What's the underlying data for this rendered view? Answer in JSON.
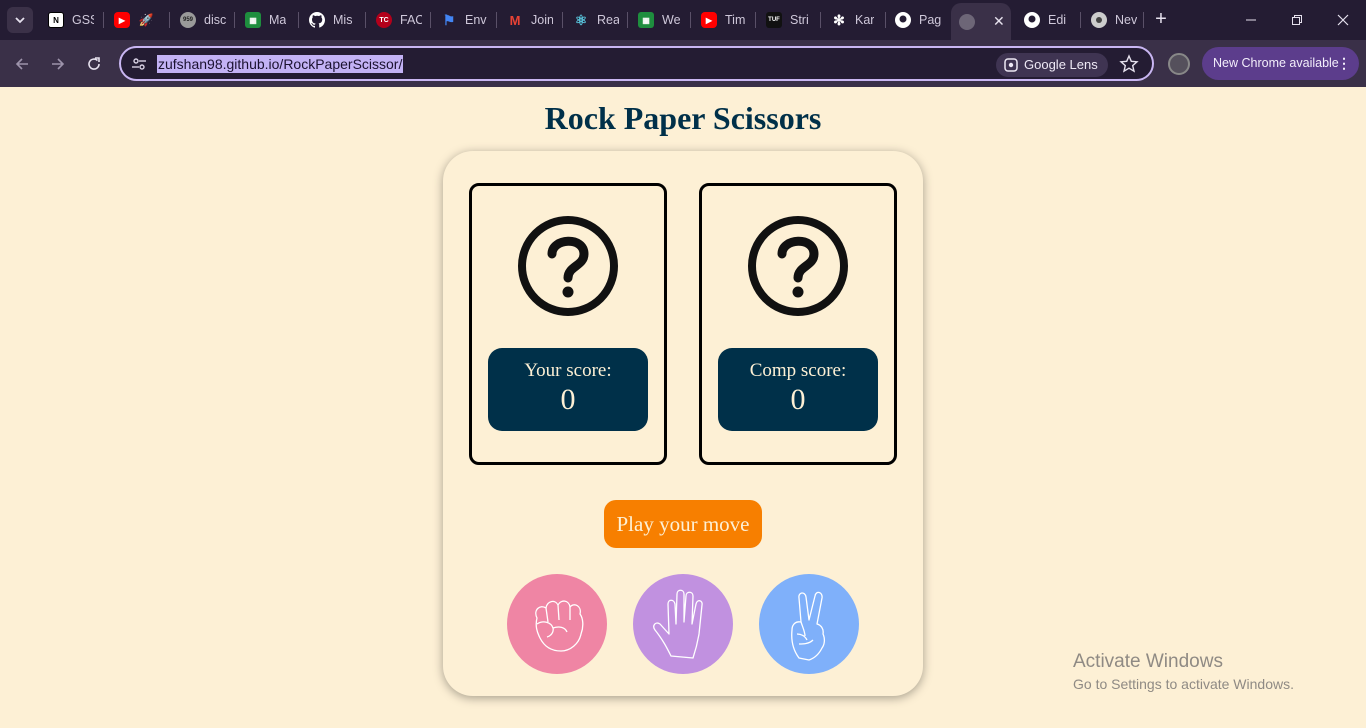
{
  "browser": {
    "tabs": [
      {
        "label": "GSS",
        "favicon": "notion-icon",
        "color": "#ffffff"
      },
      {
        "label": "",
        "favicon": "youtube-icon",
        "color": "#ff0000"
      },
      {
        "label": "disc",
        "favicon": "avatar-icon",
        "color": "#888888"
      },
      {
        "label": "Ma",
        "favicon": "sheets-icon",
        "color": "#1e8e3e"
      },
      {
        "label": "Mis",
        "favicon": "github-icon",
        "color": "#ffffff"
      },
      {
        "label": "FAC",
        "favicon": "tc-icon",
        "color": "#b3001b"
      },
      {
        "label": "Env",
        "favicon": "flag-icon",
        "color": "#4285f4"
      },
      {
        "label": "Join",
        "favicon": "gmail-icon",
        "color": "#ea4335"
      },
      {
        "label": "Rea",
        "favicon": "react-icon",
        "color": "#58c4dc"
      },
      {
        "label": "We",
        "favicon": "sheets-icon",
        "color": "#1e8e3e"
      },
      {
        "label": "Tim",
        "favicon": "youtube-icon",
        "color": "#ff0000"
      },
      {
        "label": "Stri",
        "favicon": "tuf-icon",
        "color": "#111111"
      },
      {
        "label": "Kar",
        "favicon": "openai-icon",
        "color": "#ffffff"
      },
      {
        "label": "Pag",
        "favicon": "github-icon",
        "color": "#ffffff"
      },
      {
        "label": "",
        "favicon": "globe-icon",
        "color": "#777777",
        "active": true
      },
      {
        "label": "Edi",
        "favicon": "github-icon",
        "color": "#ffffff"
      },
      {
        "label": "Nev",
        "favicon": "chrome-icon",
        "color": "#cccccc"
      }
    ],
    "url": "zufshan98.github.io/RockPaperScissor/",
    "lens_label": "Google Lens",
    "update_label": "New Chrome available"
  },
  "page": {
    "title": "Rock Paper Scissors",
    "user_score_label": "Your score:",
    "user_score": "0",
    "comp_score_label": "Comp score:",
    "comp_score": "0",
    "play_button": "Play your move",
    "choices": [
      {
        "name": "rock",
        "color": "#ef85a4"
      },
      {
        "name": "paper",
        "color": "#c191e0"
      },
      {
        "name": "scissors",
        "color": "#7fb0fa"
      }
    ]
  },
  "watermark": {
    "line1": "Activate Windows",
    "line2": "Go to Settings to activate Windows."
  },
  "colors": {
    "background": "#fdf0d5",
    "navy": "#003049",
    "orange": "#f77f00"
  }
}
